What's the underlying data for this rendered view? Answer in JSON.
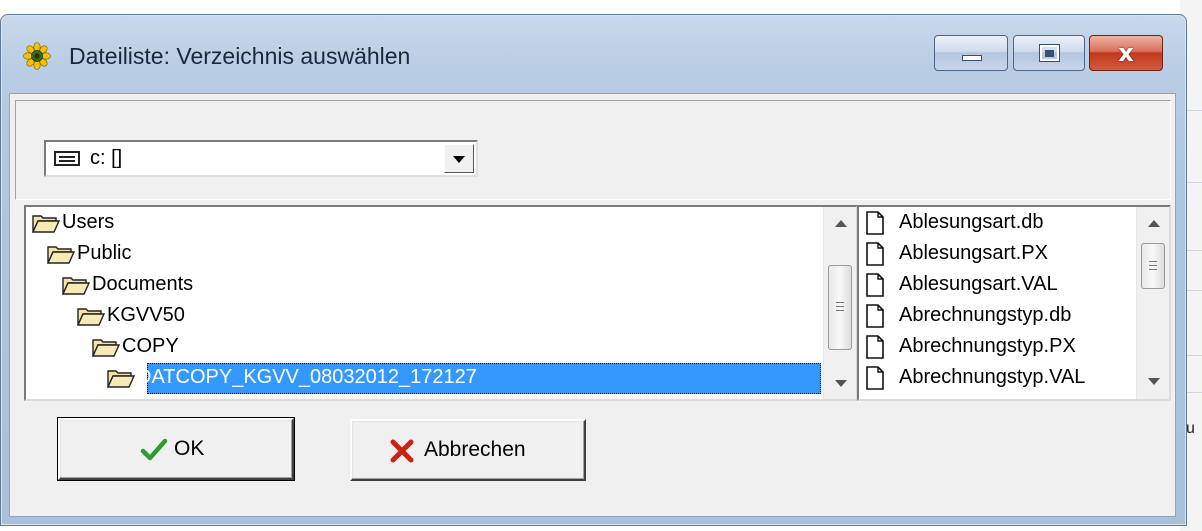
{
  "window": {
    "title": "Dateiliste: Verzeichnis auswählen",
    "close_glyph": "x"
  },
  "drive_combo": {
    "value": "c: []"
  },
  "folder_tree": {
    "items": [
      {
        "label": "Users",
        "level": 0,
        "selected": false
      },
      {
        "label": "Public",
        "level": 1,
        "selected": false
      },
      {
        "label": "Documents",
        "level": 2,
        "selected": false
      },
      {
        "label": "KGVV50",
        "level": 3,
        "selected": false
      },
      {
        "label": "COPY",
        "level": 4,
        "selected": false
      },
      {
        "label": "DATCOPY_KGVV_08032012_172127",
        "level": 5,
        "selected": true
      }
    ]
  },
  "file_list": {
    "items": [
      "Ablesungsart.db",
      "Ablesungsart.PX",
      "Ablesungsart.VAL",
      "Abrechnungstyp.db",
      "Abrechnungstyp.PX",
      "Abrechnungstyp.VAL"
    ]
  },
  "buttons": {
    "ok_label": "OK",
    "cancel_label": "Abbrechen"
  },
  "background_window": {
    "fragment": "u"
  },
  "icons": {
    "app": "sunflower-icon",
    "drive": "drive-icon",
    "folder": "open-folder-icon",
    "file": "file-icon",
    "ok": "checkmark-icon",
    "cancel": "red-x-icon"
  },
  "colors": {
    "selection": "#3399ff",
    "ok_check": "#2e9c2e",
    "cancel_x": "#cc2211",
    "close_button": "#c3391d"
  }
}
